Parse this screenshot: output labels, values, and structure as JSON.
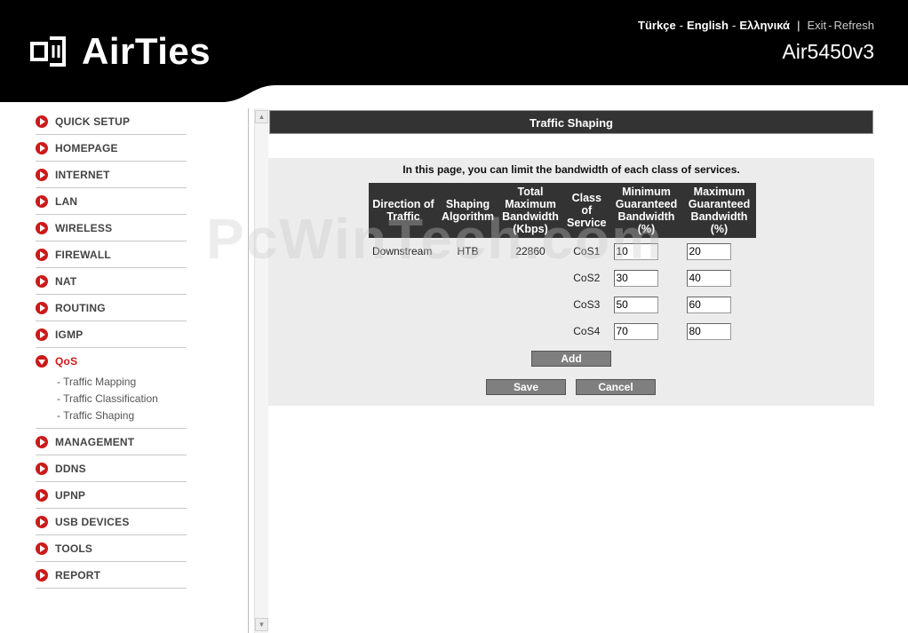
{
  "header": {
    "brand": "AirTies",
    "model": "Air5450v3",
    "languages": [
      "Türkçe",
      "English",
      "Ελληνικά"
    ],
    "exit_label": "Exit",
    "refresh_label": "Refresh",
    "bg_color": "#000000"
  },
  "sidebar": {
    "items_top": [
      {
        "label": "QUICK SETUP"
      },
      {
        "label": "HOMEPAGE"
      },
      {
        "label": "INTERNET"
      },
      {
        "label": "LAN"
      },
      {
        "label": "WIRELESS"
      },
      {
        "label": "FIREWALL"
      },
      {
        "label": "NAT"
      },
      {
        "label": "ROUTING"
      },
      {
        "label": "IGMP"
      }
    ],
    "qos": {
      "label": "QoS",
      "subitems": [
        "- Traffic Mapping",
        "- Traffic Classification",
        "- Traffic Shaping"
      ]
    },
    "items_bottom": [
      {
        "label": "MANAGEMENT"
      },
      {
        "label": "DDNS"
      },
      {
        "label": "UPNP"
      },
      {
        "label": "USB DEVICES"
      },
      {
        "label": "TOOLS"
      },
      {
        "label": "REPORT"
      }
    ],
    "accent_color": "#cc1a1a"
  },
  "main": {
    "title": "Traffic Shaping",
    "intro_bold": "In this page, you can limit the bandwidth of each class of services.",
    "columns": [
      "Direction of Traffic",
      "Shaping Algorithm",
      "Total Maximum Bandwidth (Kbps)",
      "Class of Service",
      "Minimum Guaranteed Bandwidth (%)",
      "Maximum Guaranteed Bandwidth (%)"
    ],
    "direction": "Downstream",
    "algorithm": "HTB",
    "total_bandwidth": "22860",
    "rows": [
      {
        "cos": "CoS1",
        "min": "10",
        "max": "20"
      },
      {
        "cos": "CoS2",
        "min": "30",
        "max": "40"
      },
      {
        "cos": "CoS3",
        "min": "50",
        "max": "60"
      },
      {
        "cos": "CoS4",
        "min": "70",
        "max": "80"
      }
    ],
    "add_label": "Add",
    "save_label": "Save",
    "cancel_label": "Cancel"
  },
  "watermark": "PcWinTech.com"
}
